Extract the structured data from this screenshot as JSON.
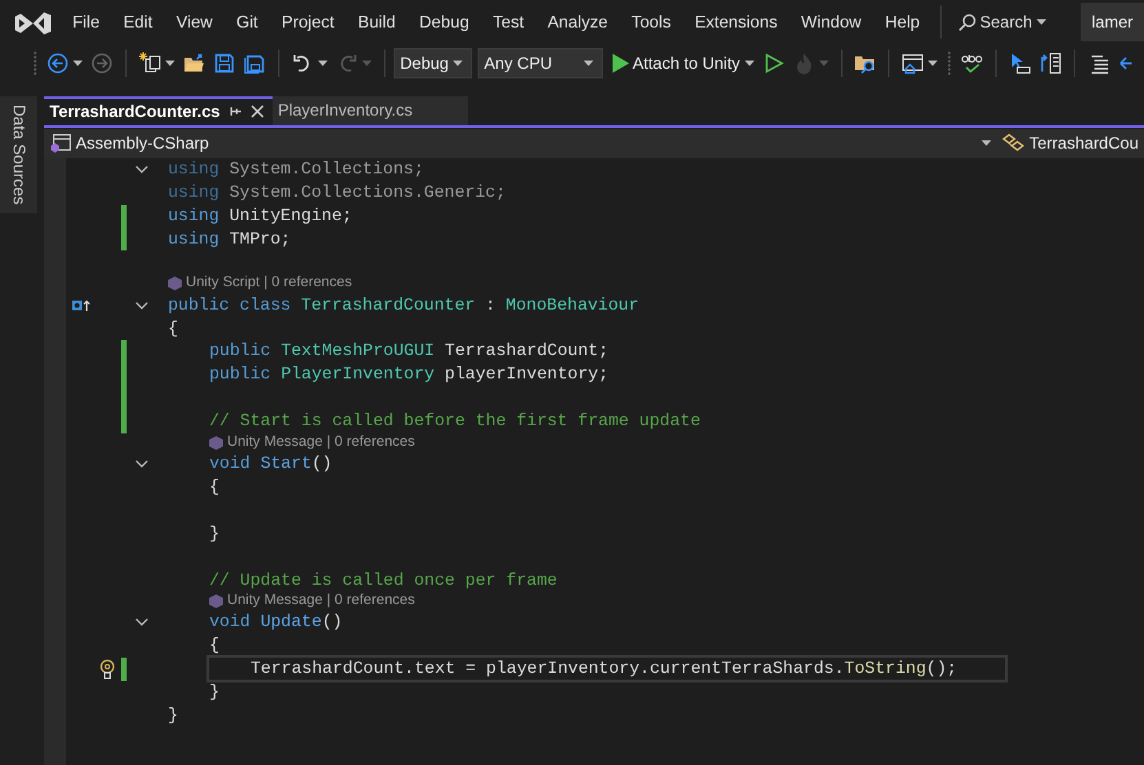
{
  "menu": [
    "File",
    "Edit",
    "View",
    "Git",
    "Project",
    "Build",
    "Debug",
    "Test",
    "Analyze",
    "Tools",
    "Extensions",
    "Window",
    "Help"
  ],
  "search": {
    "label": "Search"
  },
  "account": {
    "label": "lamer"
  },
  "toolbar": [
    {
      "kind": "grip"
    },
    {
      "kind": "icon",
      "disabled": false,
      "menu": true
    },
    {
      "kind": "icon",
      "disabled": true,
      "menu": false
    },
    {
      "kind": "separator"
    },
    {
      "kind": "icon",
      "disabled": false,
      "menu": true
    },
    {
      "kind": "icon",
      "disabled": false,
      "menu": false
    },
    {
      "kind": "icon",
      "disabled": false,
      "menu": false
    },
    {
      "kind": "icon",
      "disabled": false,
      "menu": false
    },
    {
      "kind": "separator"
    },
    {
      "kind": "icon",
      "disabled": false,
      "menu": true
    },
    {
      "kind": "icon",
      "disabled": true,
      "menu": true
    },
    {
      "kind": "separator"
    },
    {
      "kind": "select",
      "value": "Debug"
    },
    {
      "kind": "select",
      "value": "Any CPU"
    },
    {
      "kind": "run",
      "label": "Attach to Unity"
    },
    {
      "kind": "icon",
      "disabled": false,
      "menu": false
    },
    {
      "kind": "icon",
      "disabled": true,
      "menu": true
    },
    {
      "kind": "separator"
    },
    {
      "kind": "icon",
      "disabled": false,
      "menu": false
    },
    {
      "kind": "separator"
    },
    {
      "kind": "icon",
      "disabled": false,
      "menu": true
    },
    {
      "kind": "grip"
    },
    {
      "kind": "icon",
      "disabled": false,
      "menu": false
    },
    {
      "kind": "separator"
    },
    {
      "kind": "icon",
      "disabled": false,
      "menu": false
    },
    {
      "kind": "icon",
      "disabled": false,
      "menu": false
    },
    {
      "kind": "separator"
    },
    {
      "kind": "icon",
      "disabled": false,
      "menu": false
    },
    {
      "kind": "icon",
      "disabled": false,
      "menu": false
    }
  ],
  "side_tab": {
    "label": "Data Sources"
  },
  "tabs": [
    {
      "label": "TerrashardCounter.cs",
      "selected": true
    },
    {
      "label": "PlayerInventory.cs",
      "selected": false
    }
  ],
  "navigation": {
    "project": "Assembly-CSharp",
    "type": "TerrashardCou"
  },
  "code": [
    {
      "kind": "code",
      "unused": true,
      "expanded": true,
      "tokens": [
        {
          "kind": "keyword",
          "text": "using"
        },
        {
          "kind": "plain",
          "text": " System.Collections;"
        }
      ]
    },
    {
      "kind": "code",
      "unused": true,
      "tokens": [
        {
          "kind": "keyword",
          "text": "using"
        },
        {
          "kind": "plain",
          "text": " System.Collections.Generic;"
        }
      ]
    },
    {
      "kind": "code",
      "changed": true,
      "tokens": [
        {
          "kind": "keyword",
          "text": "using"
        },
        {
          "kind": "plain",
          "text": " UnityEngine;"
        }
      ]
    },
    {
      "kind": "code",
      "changed": true,
      "tokens": [
        {
          "kind": "keyword",
          "text": "using"
        },
        {
          "kind": "plain",
          "text": " TMPro;"
        }
      ]
    },
    {
      "kind": "blank"
    },
    {
      "kind": "codelens",
      "text": "Unity Script | 0 references"
    },
    {
      "kind": "code",
      "implements": true,
      "expanded": true,
      "tokens": [
        {
          "kind": "keyword",
          "text": "public class "
        },
        {
          "kind": "type",
          "text": "TerrashardCounter"
        },
        {
          "kind": "plain",
          "text": " : "
        },
        {
          "kind": "type",
          "text": "MonoBehaviour"
        }
      ]
    },
    {
      "kind": "code",
      "tokens": [
        {
          "kind": "plain",
          "text": "{"
        }
      ],
      "children": [
        {
          "kind": "code",
          "changed": true,
          "tokens": [
            {
              "kind": "keyword",
              "text": "public "
            },
            {
              "kind": "type",
              "text": "TextMeshProUGUI"
            },
            {
              "kind": "plain",
              "text": " TerrashardCount;"
            }
          ]
        },
        {
          "kind": "code",
          "changed": true,
          "tokens": [
            {
              "kind": "keyword",
              "text": "public "
            },
            {
              "kind": "type",
              "text": "PlayerInventory"
            },
            {
              "kind": "plain",
              "text": " playerInventory;"
            }
          ]
        },
        {
          "kind": "blank",
          "changed": true
        },
        {
          "kind": "code",
          "changed": true,
          "tokens": [
            {
              "kind": "comment",
              "text": "// Start is called before the first frame update"
            }
          ]
        },
        {
          "kind": "codelens",
          "text": "Unity Message | 0 references"
        },
        {
          "kind": "code",
          "expanded": true,
          "tokens": [
            {
              "kind": "keyword",
              "text": "void "
            },
            {
              "kind": "message",
              "text": "Start"
            },
            {
              "kind": "plain",
              "text": "()"
            }
          ]
        },
        {
          "kind": "code",
          "tokens": [
            {
              "kind": "plain",
              "text": "{"
            }
          ],
          "children": [
            {
              "kind": "blank"
            }
          ]
        },
        {
          "kind": "code",
          "tokens": [
            {
              "kind": "plain",
              "text": "}"
            }
          ]
        },
        {
          "kind": "blank"
        },
        {
          "kind": "code",
          "tokens": [
            {
              "kind": "comment",
              "text": "// Update is called once per frame"
            }
          ]
        },
        {
          "kind": "codelens",
          "text": "Unity Message | 0 references"
        },
        {
          "kind": "code",
          "expanded": true,
          "tokens": [
            {
              "kind": "keyword",
              "text": "void "
            },
            {
              "kind": "message",
              "text": "Update"
            },
            {
              "kind": "plain",
              "text": "()"
            }
          ]
        },
        {
          "kind": "code",
          "tokens": [
            {
              "kind": "plain",
              "text": "{"
            }
          ],
          "children": [
            {
              "kind": "code",
              "changed": true,
              "current": true,
              "quick_actions": true,
              "tokens": [
                {
                  "kind": "plain",
                  "text": "TerrashardCount.text = playerInventory.currentTerraShards."
                },
                {
                  "kind": "method",
                  "text": "ToString"
                },
                {
                  "kind": "plain",
                  "text": "();"
                }
              ]
            }
          ]
        },
        {
          "kind": "code",
          "tokens": [
            {
              "kind": "plain",
              "text": "}"
            }
          ]
        }
      ]
    },
    {
      "kind": "code",
      "tokens": [
        {
          "kind": "plain",
          "text": "}"
        }
      ]
    }
  ]
}
